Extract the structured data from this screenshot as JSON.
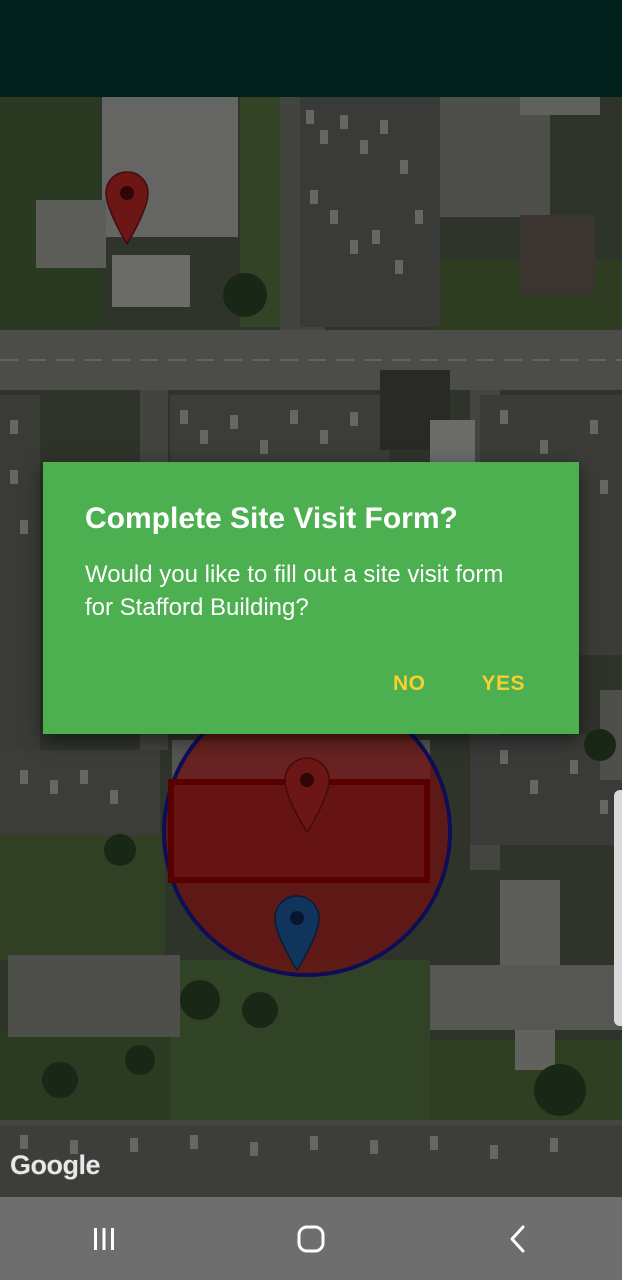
{
  "dialog": {
    "title": "Complete Site Visit Form?",
    "message": "Would you like to fill out a site visit form for Stafford Building?",
    "no_label": "NO",
    "yes_label": "YES"
  },
  "map": {
    "attribution": "Google",
    "geofence_color": "#cc1b1b",
    "geofence_border_color": "#1a1a9e",
    "building_marker_color": "#c62828",
    "user_marker_color": "#1e5fa8"
  },
  "colors": {
    "status_bar": "#003d33",
    "dialog_background": "#4caf50",
    "dialog_button_text": "#f5d033",
    "nav_bar": "#6e6e6e"
  },
  "nav": {
    "recents_icon": "recent-apps-icon",
    "home_icon": "home-icon",
    "back_icon": "back-icon"
  }
}
